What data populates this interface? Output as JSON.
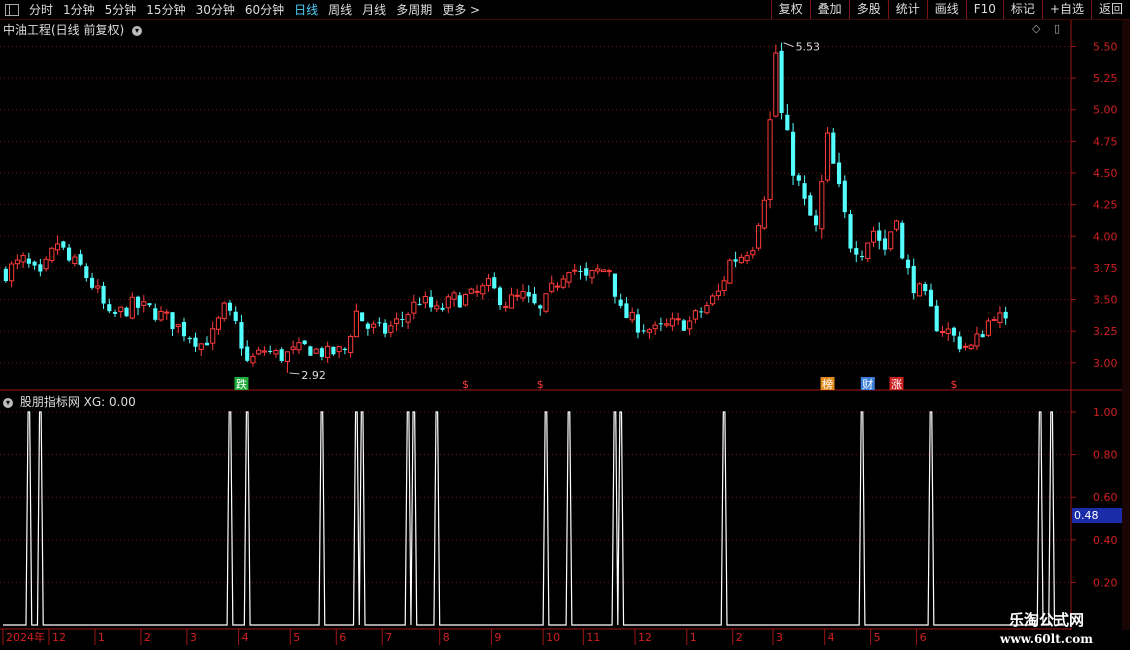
{
  "toolbar": {
    "periods": [
      "分时",
      "1分钟",
      "5分钟",
      "15分钟",
      "30分钟",
      "60分钟",
      "日线",
      "周线",
      "月线",
      "多周期",
      "更多 >"
    ],
    "active_period": "日线",
    "buttons": [
      "复权",
      "叠加",
      "多股",
      "统计",
      "画线",
      "F10",
      "标记",
      "+自选",
      "返回"
    ]
  },
  "main_title": "中油工程(日线 前复权)",
  "indicator_title": "股朋指标网 XG: 0.00",
  "price_axis": {
    "labels": [
      "5.50",
      "5.25",
      "5.00",
      "4.75",
      "4.50",
      "4.25",
      "4.00",
      "3.75",
      "3.50",
      "3.25",
      "3.00"
    ]
  },
  "indicator_axis": {
    "labels": [
      "1.00",
      "0.80",
      "0.60",
      "0.40",
      "0.20"
    ]
  },
  "cursor_value": "0.48",
  "annotations": {
    "high": "5.53",
    "low": "2.92"
  },
  "markers": [
    {
      "text": "跌",
      "bar": 41,
      "color": "#1faa3a",
      "boxed": true
    },
    {
      "text": "$",
      "bar": 80,
      "color": "#ff3b3b",
      "boxed": false
    },
    {
      "text": "$",
      "bar": 93,
      "color": "#ff3b3b",
      "boxed": false
    },
    {
      "text": "榜",
      "bar": 143,
      "color": "#e08a1e",
      "boxed": true
    },
    {
      "text": "财",
      "bar": 150,
      "color": "#3a7dd8",
      "boxed": true
    },
    {
      "text": "涨",
      "bar": 155,
      "color": "#cc2222",
      "boxed": true
    },
    {
      "text": "$",
      "bar": 165,
      "color": "#ff3b3b",
      "boxed": false
    }
  ],
  "date_axis": [
    {
      "label": "2024年",
      "bar": 0
    },
    {
      "label": "12",
      "bar": 8
    },
    {
      "label": "1",
      "bar": 16
    },
    {
      "label": "2",
      "bar": 24
    },
    {
      "label": "3",
      "bar": 32
    },
    {
      "label": "4",
      "bar": 41
    },
    {
      "label": "5",
      "bar": 50
    },
    {
      "label": "6",
      "bar": 58
    },
    {
      "label": "7",
      "bar": 66
    },
    {
      "label": "8",
      "bar": 76
    },
    {
      "label": "9",
      "bar": 85
    },
    {
      "label": "10",
      "bar": 94
    },
    {
      "label": "11",
      "bar": 101
    },
    {
      "label": "12",
      "bar": 110
    },
    {
      "label": "1",
      "bar": 119
    },
    {
      "label": "2",
      "bar": 127
    },
    {
      "label": "3",
      "bar": 134
    },
    {
      "label": "4",
      "bar": 143
    },
    {
      "label": "5",
      "bar": 151
    },
    {
      "label": "6",
      "bar": 159
    }
  ],
  "watermark": {
    "line1": "乐淘公式网",
    "line2": "www.60lt.com"
  },
  "chart_data": {
    "type": "candlestick",
    "price_ylim": [
      2.88,
      5.63
    ],
    "price": {
      "anchors": [
        [
          0,
          3.72
        ],
        [
          3,
          3.8
        ],
        [
          6,
          3.66
        ],
        [
          9,
          3.95
        ],
        [
          11,
          3.8
        ],
        [
          13,
          3.75
        ],
        [
          16,
          3.55
        ],
        [
          18,
          3.35
        ],
        [
          20,
          3.4
        ],
        [
          22,
          3.45
        ],
        [
          25,
          3.42
        ],
        [
          28,
          3.35
        ],
        [
          31,
          3.25
        ],
        [
          34,
          3.15
        ],
        [
          36,
          3.22
        ],
        [
          38,
          3.42
        ],
        [
          40,
          3.3
        ],
        [
          42,
          3.0
        ],
        [
          45,
          3.1
        ],
        [
          48,
          3.05
        ],
        [
          52,
          3.12
        ],
        [
          56,
          3.07
        ],
        [
          59,
          3.1
        ],
        [
          61,
          3.4
        ],
        [
          63,
          3.28
        ],
        [
          66,
          3.25
        ],
        [
          69,
          3.35
        ],
        [
          72,
          3.5
        ],
        [
          75,
          3.4
        ],
        [
          78,
          3.5
        ],
        [
          81,
          3.52
        ],
        [
          84,
          3.6
        ],
        [
          87,
          3.48
        ],
        [
          90,
          3.52
        ],
        [
          93,
          3.4
        ],
        [
          96,
          3.65
        ],
        [
          98,
          3.78
        ],
        [
          101,
          3.65
        ],
        [
          103,
          3.72
        ],
        [
          105,
          3.75
        ],
        [
          107,
          3.4
        ],
        [
          110,
          3.3
        ],
        [
          113,
          3.25
        ],
        [
          116,
          3.3
        ],
        [
          119,
          3.32
        ],
        [
          122,
          3.45
        ],
        [
          124,
          3.55
        ],
        [
          126,
          3.8
        ],
        [
          128,
          3.85
        ],
        [
          130,
          3.95
        ],
        [
          132,
          4.35
        ],
        [
          134,
          5.45
        ],
        [
          135,
          4.95
        ],
        [
          137,
          4.55
        ],
        [
          139,
          4.25
        ],
        [
          141,
          4.05
        ],
        [
          143,
          4.75
        ],
        [
          145,
          4.35
        ],
        [
          147,
          3.95
        ],
        [
          149,
          3.9
        ],
        [
          151,
          4.05
        ],
        [
          153,
          3.9
        ],
        [
          155,
          4.2
        ],
        [
          156,
          3.8
        ],
        [
          158,
          3.62
        ],
        [
          160,
          3.5
        ],
        [
          162,
          3.3
        ],
        [
          164,
          3.25
        ],
        [
          166,
          3.15
        ],
        [
          168,
          3.12
        ],
        [
          170,
          3.25
        ],
        [
          172,
          3.4
        ],
        [
          174,
          3.3
        ]
      ],
      "high": 5.53,
      "low": 2.92
    },
    "indicator": {
      "type": "spike",
      "ylim": [
        0,
        1.0
      ],
      "baseline": 0.0,
      "spikes": [
        {
          "bars": [
            4,
            6
          ],
          "value": 1.0
        },
        {
          "bars": [
            39,
            42
          ],
          "value": 1.0
        },
        {
          "bars": [
            55
          ],
          "value": 1.0
        },
        {
          "bars": [
            61,
            62
          ],
          "value": 1.0
        },
        {
          "bars": [
            70,
            71
          ],
          "value": 1.0
        },
        {
          "bars": [
            75
          ],
          "value": 1.0
        },
        {
          "bars": [
            94,
            98
          ],
          "value": 1.0
        },
        {
          "bars": [
            106,
            107
          ],
          "value": 1.0
        },
        {
          "bars": [
            125
          ],
          "value": 1.0
        },
        {
          "bars": [
            149
          ],
          "value": 1.0
        },
        {
          "bars": [
            161
          ],
          "value": 1.0
        },
        {
          "bars": [
            180,
            182
          ],
          "value": 1.0
        }
      ]
    }
  }
}
